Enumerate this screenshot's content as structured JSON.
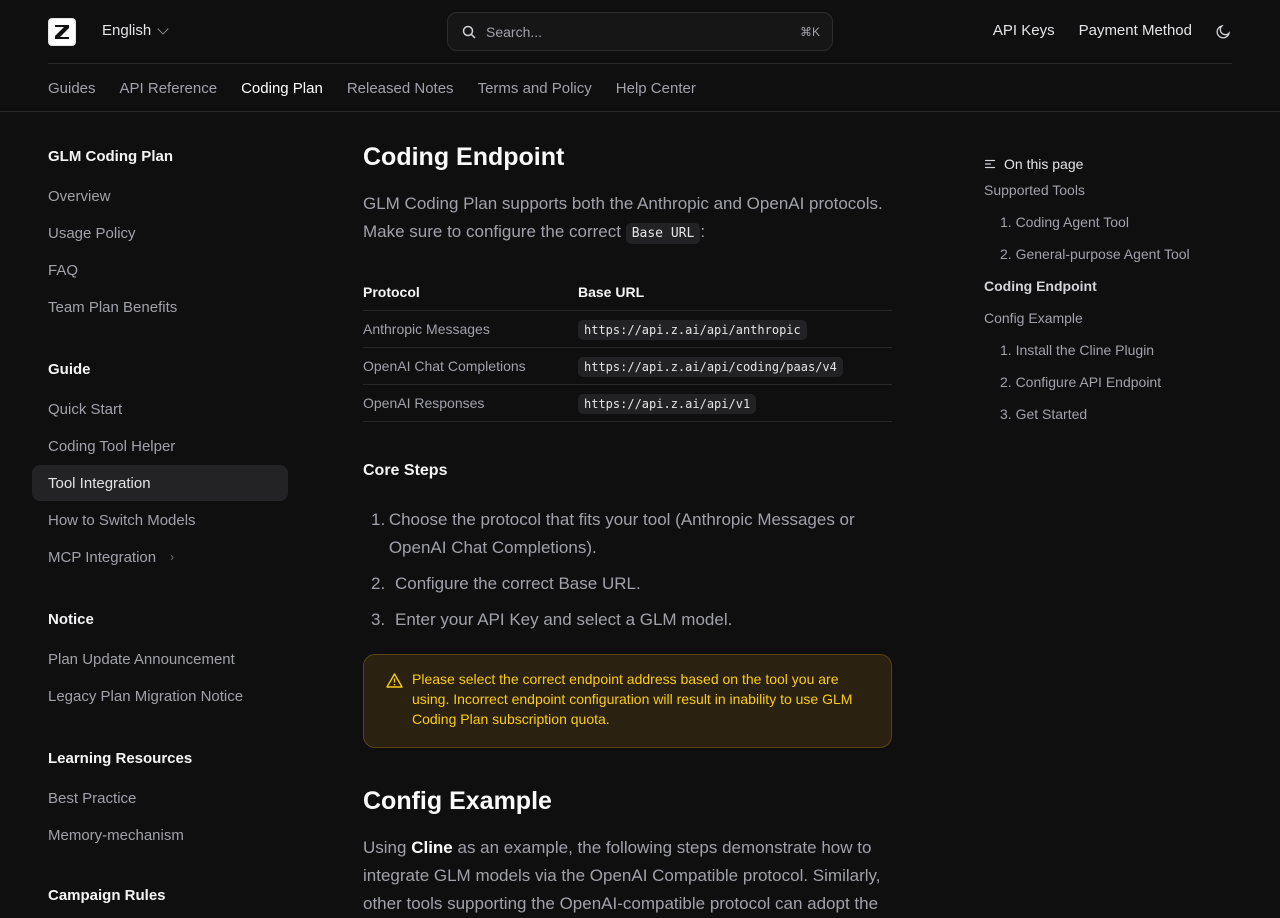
{
  "header": {
    "language": "English",
    "search_placeholder": "Search...",
    "search_shortcut": "⌘K",
    "links": [
      "API Keys",
      "Payment Method"
    ]
  },
  "nav_tabs": [
    {
      "label": "Guides"
    },
    {
      "label": "API Reference"
    },
    {
      "label": "Coding Plan",
      "active": true
    },
    {
      "label": "Released Notes"
    },
    {
      "label": "Terms and Policy"
    },
    {
      "label": "Help Center"
    }
  ],
  "sidebar": {
    "sections": [
      {
        "title": "GLM Coding Plan",
        "items": [
          "Overview",
          "Usage Policy",
          "FAQ",
          "Team Plan Benefits"
        ]
      },
      {
        "title": "Guide",
        "items": [
          "Quick Start",
          "Coding Tool Helper",
          "Tool Integration",
          "How to Switch Models",
          "MCP Integration"
        ]
      },
      {
        "title": "Notice",
        "items": [
          "Plan Update Announcement",
          "Legacy Plan Migration Notice"
        ]
      },
      {
        "title": "Learning Resources",
        "items": [
          "Best Practice",
          "Memory-mechanism"
        ]
      },
      {
        "title": "Campaign Rules",
        "items": []
      }
    ],
    "active_item": "Tool Integration"
  },
  "main": {
    "title": "Coding Endpoint",
    "intro_text": "GLM Coding Plan supports both the Anthropic and OpenAI protocols. Make sure to configure the correct",
    "intro_code": "Base URL",
    "intro_suffix": ":",
    "table": {
      "headers": [
        "Protocol",
        "Base URL"
      ],
      "rows": [
        [
          "Anthropic Messages",
          "https://api.z.ai/api/anthropic"
        ],
        [
          "OpenAI Chat Completions",
          "https://api.z.ai/api/coding/paas/v4"
        ],
        [
          "OpenAI Responses",
          "https://api.z.ai/api/v1"
        ]
      ]
    },
    "core_steps_title": "Core Steps",
    "core_steps": [
      "Choose the protocol that fits your tool (Anthropic Messages or OpenAI Chat Completions).",
      "Configure the correct Base URL.",
      "Enter your API Key and select a GLM model."
    ],
    "warning": "Please select the correct endpoint address based on the tool you are using. Incorrect endpoint configuration will result in inability to use GLM Coding Plan subscription quota.",
    "config_title": "Config Example",
    "config_intro_prefix": "Using",
    "config_intro_bold": "Cline",
    "config_intro_rest": "as an example, the following steps demonstrate how to integrate GLM models via the OpenAI Compatible protocol. Similarly,",
    "config_intro_cut": "other tools supporting the OpenAI-compatible protocol can adopt the"
  },
  "toc": {
    "title": "On this page",
    "items": [
      {
        "label": "Supported Tools",
        "level": 1
      },
      {
        "label": "1. Coding Agent Tool",
        "level": 2
      },
      {
        "label": "2. General-purpose Agent Tool",
        "level": 2
      },
      {
        "label": "Coding Endpoint",
        "level": 1,
        "active": true
      },
      {
        "label": "Config Example",
        "level": 1
      },
      {
        "label": "1. Install the Cline Plugin",
        "level": 2
      },
      {
        "label": "2. Configure API Endpoint",
        "level": 2
      },
      {
        "label": "3. Get Started",
        "level": 2
      }
    ]
  },
  "colors": {
    "background": "#0f0f10",
    "warning_text": "#facc15",
    "warning_bg": "#2a2110"
  }
}
